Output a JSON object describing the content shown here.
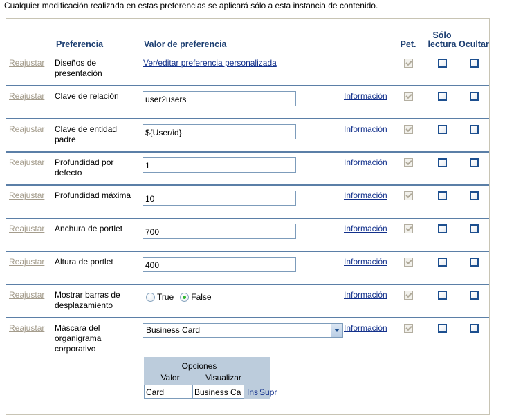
{
  "intro": {
    "note": "Cualquier modificación realizada en estas preferencias se aplicará sólo a esta instancia de contenido."
  },
  "table": {
    "headers": {
      "reset": "",
      "preference": "Preferencia",
      "value": "Valor de preferencia",
      "info": "",
      "pet": "Pet.",
      "readonly_line1": "Sólo",
      "readonly_line2": "lectura",
      "hidden": "Ocultar"
    },
    "reset_label": "Reajustar",
    "info_label": "Información",
    "rows": [
      {
        "name": "Diseños de presentación",
        "control": "link",
        "link_text": "Ver/editar preferencia personalizada",
        "has_info": false,
        "pet_checked": true,
        "readonly_checked": false,
        "hidden_checked": false
      },
      {
        "name": "Clave de relación",
        "control": "text",
        "value": "user2users",
        "has_info": true,
        "pet_checked": true,
        "readonly_checked": false,
        "hidden_checked": false
      },
      {
        "name": "Clave de entidad padre",
        "control": "text",
        "value": "${User/id}",
        "has_info": true,
        "pet_checked": true,
        "readonly_checked": false,
        "hidden_checked": false
      },
      {
        "name": "Profundidad por defecto",
        "control": "text",
        "value": "1",
        "has_info": true,
        "pet_checked": true,
        "readonly_checked": false,
        "hidden_checked": false
      },
      {
        "name": "Profundidad máxima",
        "control": "text",
        "value": "10",
        "has_info": true,
        "pet_checked": true,
        "readonly_checked": false,
        "hidden_checked": false
      },
      {
        "name": "Anchura de portlet",
        "control": "text",
        "value": "700",
        "has_info": true,
        "pet_checked": true,
        "readonly_checked": false,
        "hidden_checked": false
      },
      {
        "name": "Altura de portlet",
        "control": "text",
        "value": "400",
        "has_info": true,
        "pet_checked": true,
        "readonly_checked": false,
        "hidden_checked": false
      },
      {
        "name": "Mostrar barras de desplazamiento",
        "control": "radio",
        "options": [
          {
            "label": "True",
            "selected": false
          },
          {
            "label": "False",
            "selected": true
          }
        ],
        "has_info": true,
        "pet_checked": true,
        "readonly_checked": false,
        "hidden_checked": false
      },
      {
        "name": "Máscara del organigrama corporativo",
        "control": "select",
        "value": "Business Card",
        "has_info": true,
        "pet_checked": true,
        "readonly_checked": false,
        "hidden_checked": false
      }
    ]
  },
  "options_panel": {
    "title": "Opciones",
    "col_value": "Valor",
    "col_display": "Visualizar",
    "row": {
      "value": "Card",
      "display": "Business Ca",
      "insert_label": "Ins",
      "delete_label": "Supr"
    }
  }
}
